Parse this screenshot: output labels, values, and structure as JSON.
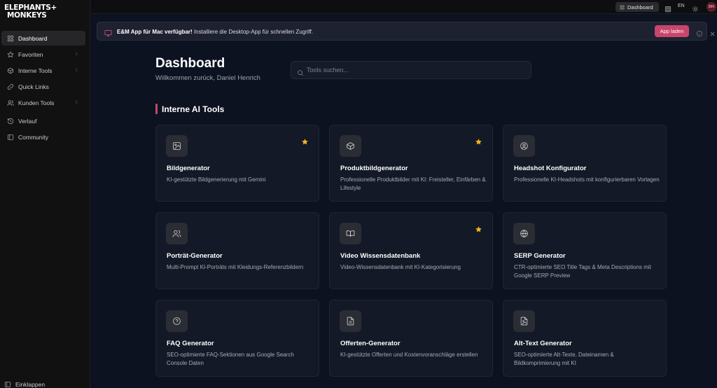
{
  "logo": {
    "line1": "ELEPHANTS+",
    "line2": "MONKEYS"
  },
  "sidebar": {
    "items": [
      {
        "label": "Dashboard",
        "icon": "dashboard-icon",
        "active": true
      },
      {
        "label": "Favoriten",
        "icon": "star-icon",
        "chevron": true
      },
      {
        "label": "Interne Tools",
        "icon": "box-icon",
        "chevron": true
      },
      {
        "label": "Quick Links",
        "icon": "link-icon"
      },
      {
        "label": "Kunden Tools",
        "icon": "users-icon",
        "chevron": true
      },
      {
        "label": "Verlauf",
        "icon": "history-icon"
      },
      {
        "label": "Community",
        "icon": "community-icon"
      }
    ],
    "collapse_label": "Einklappen"
  },
  "topbar": {
    "dashboard_label": "Dashboard",
    "language": "EN",
    "avatar_initials": "DH"
  },
  "banner": {
    "title": "E&M App für Mac verfügbar!",
    "text": "Installiere die Desktop-App für schnellen Zugriff.",
    "button_label": "App laden"
  },
  "header": {
    "title": "Dashboard",
    "subtitle": "Willkommen zurück, Daniel Henrich"
  },
  "search": {
    "placeholder": "Tools suchen..."
  },
  "section": {
    "title": "Interne AI Tools"
  },
  "cards": [
    {
      "title": "Bildgenerator",
      "desc": "KI-gestützte Bildgenerierung mit Gemini",
      "icon": "image-icon",
      "favorite": true
    },
    {
      "title": "Produktbildgenerator",
      "desc": "Professionelle Produktbilder mit KI: Freisteller, Einfärben & Lifestyle",
      "icon": "package-icon",
      "favorite": true
    },
    {
      "title": "Headshot Konfigurator",
      "desc": "Professionelle KI-Headshots mit konfigurierbaren Vorlagen",
      "icon": "user-circle-icon",
      "favorite": false
    },
    {
      "title": "Porträt-Generator",
      "desc": "Multi-Prompt KI-Porträts mit Kleidungs-Referenzbildern",
      "icon": "users-icon",
      "favorite": false
    },
    {
      "title": "Video Wissensdatenbank",
      "desc": "Video-Wissensdatenbank mit KI-Kategorisierung",
      "icon": "book-open-icon",
      "favorite": true
    },
    {
      "title": "SERP Generator",
      "desc": "CTR-optimierte SEO Title Tags & Meta Descriptions mit Google SERP Preview",
      "icon": "globe-icon",
      "favorite": false
    },
    {
      "title": "FAQ Generator",
      "desc": "SEO-optimierte FAQ-Sektionen aus Google Search Console Daten",
      "icon": "help-circle-icon",
      "favorite": false
    },
    {
      "title": "Offerten-Generator",
      "desc": "KI-gestützte Offerten und Kostenvoranschläge erstellen",
      "icon": "file-text-icon",
      "favorite": false
    },
    {
      "title": "Alt-Text Generator",
      "desc": "SEO-optimierte Alt-Texte, Dateinamen & Bildkomprimierung mit KI",
      "icon": "file-image-icon",
      "favorite": false
    }
  ],
  "colors": {
    "accent": "#c8456b",
    "background": "#0c1220",
    "sidebar": "#111111",
    "card": "#131927",
    "star": "#f3b51c"
  }
}
